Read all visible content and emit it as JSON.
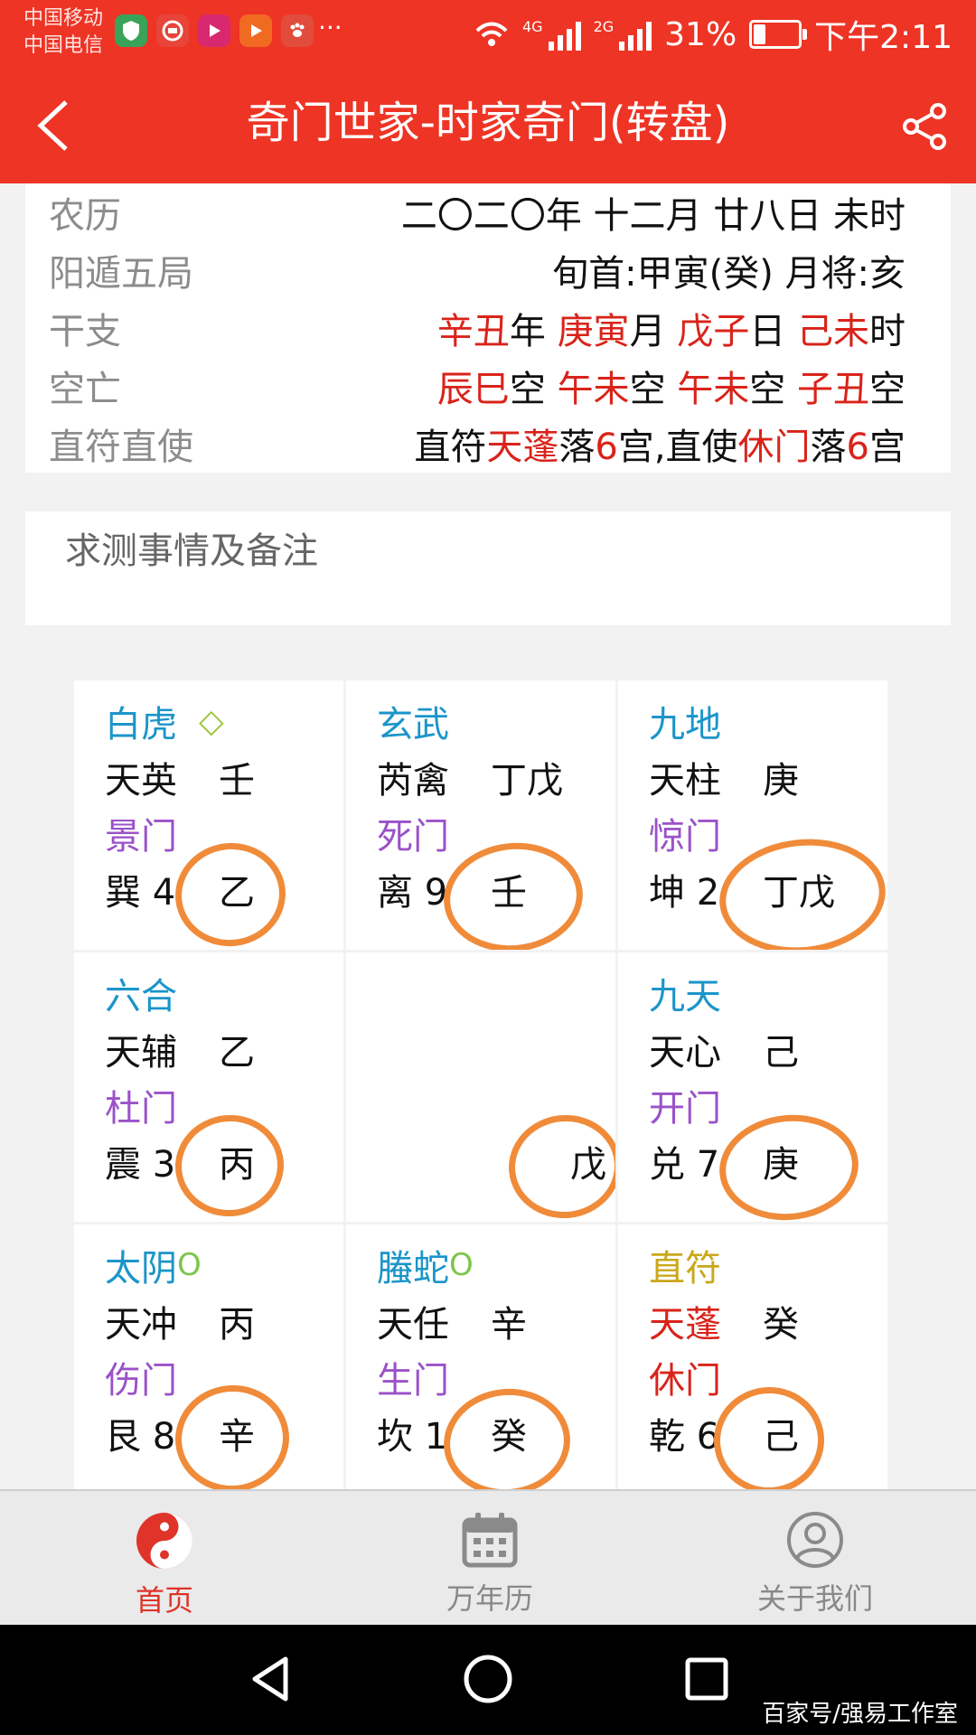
{
  "status_bar": {
    "carrier_1": "中国移动",
    "carrier_2": "中国电信",
    "more": "···",
    "net_1": "4G",
    "net_2": "2G",
    "battery": "31%",
    "time": "下午2:11"
  },
  "header": {
    "title": "奇门世家-时家奇门(转盘)"
  },
  "info": {
    "lunar_label": "农历",
    "lunar_value": "二〇二〇年 十二月 廿八日 未时",
    "ju_label": "阳遁五局",
    "ju_value": "旬首:甲寅(癸) 月将:亥",
    "ganzhi_label": "干支",
    "ganzhi": {
      "year_gz": "辛丑",
      "year": "年",
      "month_gz": "庚寅",
      "month": "月",
      "day_gz": "戊子",
      "day": "日",
      "hour_gz": "己未",
      "hour": "时"
    },
    "kongwang_label": "空亡",
    "kongwang": {
      "k1": "辰巳",
      "k2": "午未",
      "k3": "午未",
      "k4": "子丑",
      "suffix": "空"
    },
    "zhifu_label": "直符直使",
    "zhifu": {
      "p1": "直符",
      "star": "天蓬",
      "p2": "落",
      "n1": "6",
      "p3": "宫,直使",
      "gate": "休门",
      "p4": "落",
      "n2": "6",
      "p5": "宫"
    }
  },
  "notes": {
    "placeholder": "求测事情及备注"
  },
  "palaces": {
    "xun": {
      "god": "白虎",
      "god_mark": "◇",
      "star": "天英",
      "star_stem": "壬",
      "gate": "景门",
      "palace": "巽 4",
      "earth_stem": "乙"
    },
    "li": {
      "god": "玄武",
      "star": "芮禽",
      "star_stem": "丁戊",
      "gate": "死门",
      "palace": "离 9",
      "earth_stem": "壬"
    },
    "kun": {
      "god": "九地",
      "star": "天柱",
      "star_stem": "庚",
      "gate": "惊门",
      "palace": "坤 2",
      "earth_stem": "丁戊"
    },
    "zhen": {
      "god": "六合",
      "star": "天辅",
      "star_stem": "乙",
      "gate": "杜门",
      "palace": "震 3",
      "earth_stem": "丙"
    },
    "center": {
      "earth_stem": "戊"
    },
    "dui": {
      "god": "九天",
      "star": "天心",
      "star_stem": "己",
      "gate": "开门",
      "palace": "兑 7",
      "earth_stem": "庚"
    },
    "gen": {
      "god": "太阴",
      "god_mark": "O",
      "star": "天冲",
      "star_stem": "丙",
      "gate": "伤门",
      "palace": "艮 8",
      "earth_stem": "辛"
    },
    "kan": {
      "god": "螣蛇",
      "god_mark": "O",
      "star": "天任",
      "star_stem": "辛",
      "gate": "生门",
      "palace": "坎 1",
      "earth_stem": "癸"
    },
    "qian": {
      "god": "直符",
      "star": "天蓬",
      "star_stem": "癸",
      "gate": "休门",
      "palace": "乾 6",
      "earth_stem": "己"
    }
  },
  "tabs": [
    {
      "label": "首页",
      "icon": "yin-yang-icon",
      "active": true
    },
    {
      "label": "万年历",
      "icon": "calendar-icon",
      "active": false
    },
    {
      "label": "关于我们",
      "icon": "user-icon",
      "active": false
    }
  ],
  "watermark": "百家号/强易工作室",
  "colors": {
    "primary": "#ee3425",
    "highlight": "#d9231a",
    "god": "#1b95c9",
    "gate": "#9b52c9",
    "zhifu_god": "#c9a81b",
    "annotation": "#f08b3a"
  }
}
